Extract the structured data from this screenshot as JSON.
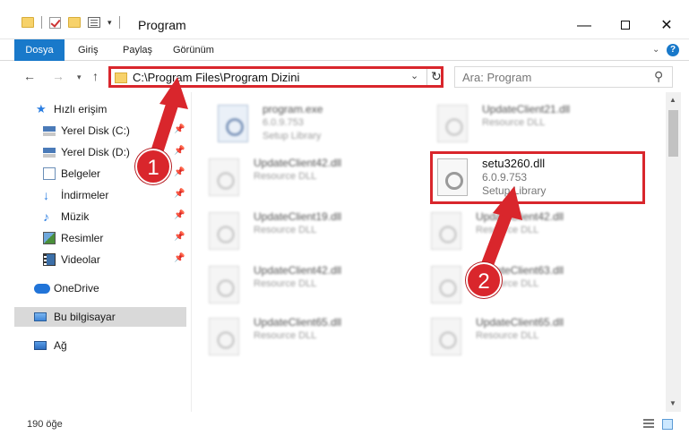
{
  "window": {
    "title": "Program",
    "minimize": "—",
    "close": "✕"
  },
  "ribbon": {
    "tabs": [
      "Dosya",
      "Giriş",
      "Paylaş",
      "Görünüm"
    ],
    "help": "?"
  },
  "address": {
    "path": "C:\\Program Files\\Program Dizini",
    "search_placeholder": "Ara: Program"
  },
  "sidebar": {
    "items": [
      {
        "label": "Hızlı erişim",
        "icon": "star-icon"
      },
      {
        "label": "Yerel Disk (C:)",
        "icon": "disk-icon",
        "pinned": true
      },
      {
        "label": "Yerel Disk (D:)",
        "icon": "disk-icon",
        "pinned": true
      },
      {
        "label": "Belgeler",
        "icon": "documents-icon",
        "pinned": true
      },
      {
        "label": "İndirmeler",
        "icon": "download-icon",
        "pinned": true
      },
      {
        "label": "Müzik",
        "icon": "music-icon",
        "pinned": true
      },
      {
        "label": "Resimler",
        "icon": "pictures-icon",
        "pinned": true
      },
      {
        "label": "Videolar",
        "icon": "videos-icon",
        "pinned": true
      },
      {
        "label": "OneDrive",
        "icon": "cloud-icon"
      },
      {
        "label": "Bu bilgisayar",
        "icon": "computer-icon",
        "selected": true
      },
      {
        "label": "Ağ",
        "icon": "network-icon"
      }
    ]
  },
  "files": [
    {
      "name": "program.exe",
      "line1": "6.0.9.753",
      "line2": "Setup Library",
      "type": "exe"
    },
    {
      "name": "UpdateClient21.dll",
      "line1": "Resource DLL",
      "line2": ""
    },
    {
      "name": "UpdateClient42.dll",
      "line1": "Resource DLL",
      "line2": ""
    },
    {
      "name": "setu3260.dll",
      "line1": "6.0.9.753",
      "line2": "Setup Library",
      "focus": true
    },
    {
      "name": "UpdateClient19.dll",
      "line1": "Resource DLL",
      "line2": ""
    },
    {
      "name": "UpdateClient42.dll",
      "line1": "Resource DLL",
      "line2": ""
    },
    {
      "name": "UpdateClient42.dll",
      "line1": "Resource DLL",
      "line2": ""
    },
    {
      "name": "UpdateClient63.dll",
      "line1": "Resource DLL",
      "line2": ""
    },
    {
      "name": "UpdateClient65.dll",
      "line1": "Resource DLL",
      "line2": ""
    },
    {
      "name": "UpdateClient65.dll",
      "line1": "Resource DLL",
      "line2": ""
    }
  ],
  "status": {
    "count": "190 öğe"
  },
  "annotations": {
    "step1": "1",
    "step2": "2",
    "color": "#d9262c"
  }
}
